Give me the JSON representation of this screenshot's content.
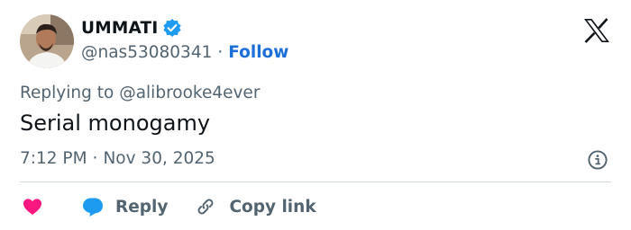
{
  "author": {
    "display_name": "UMMATI",
    "handle": "@nas53080341",
    "separator": "·",
    "follow_label": "Follow",
    "verified": true
  },
  "reply_context": {
    "prefix": "Replying to",
    "target": "@alibrooke4ever"
  },
  "tweet": {
    "text": "Serial monogamy",
    "time": "7:12 PM",
    "separator": "·",
    "date": "Nov 30, 2025"
  },
  "actions": {
    "like_icon": "heart-icon",
    "reply_label": "Reply",
    "copy_link_label": "Copy link"
  },
  "colors": {
    "accent": "#1d9bf0",
    "follow_link": "#1d6fd8",
    "like": "#f91880",
    "muted_text": "#536471",
    "divider": "#cfd9de"
  }
}
